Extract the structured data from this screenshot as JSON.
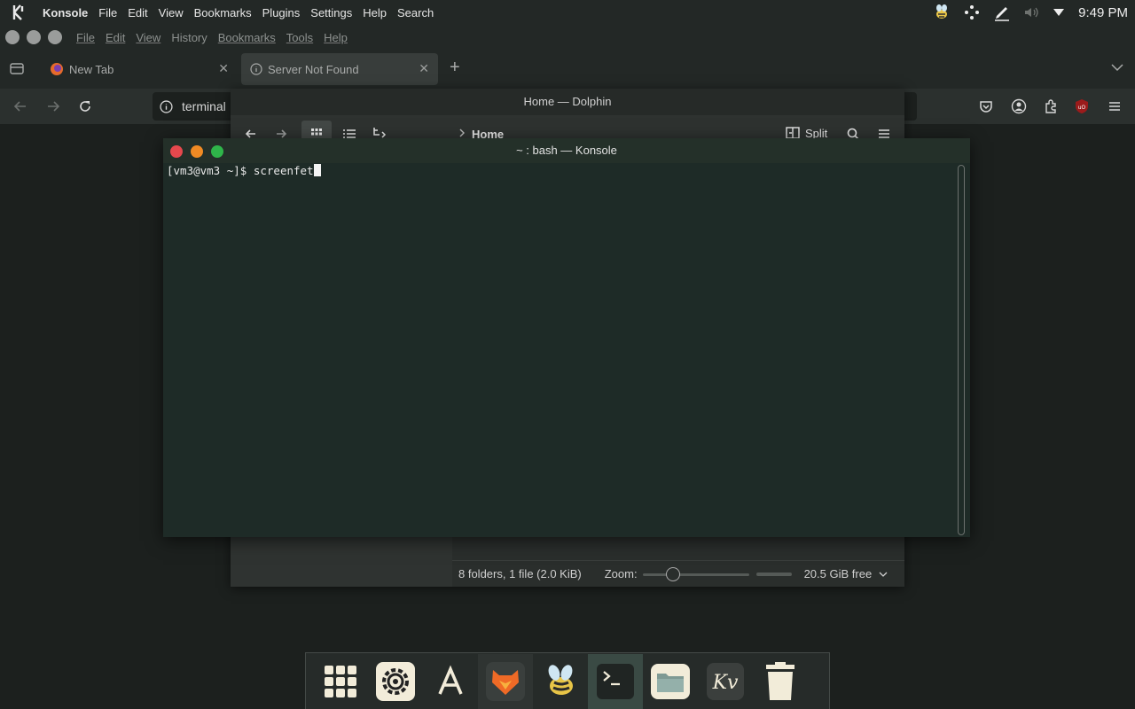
{
  "top_panel": {
    "app_name": "Konsole",
    "menu": [
      "File",
      "Edit",
      "View",
      "Bookmarks",
      "Plugins",
      "Settings",
      "Help",
      "Search"
    ],
    "tray_icons": [
      "bee-icon",
      "network-icon",
      "pen-icon",
      "volume-icon",
      "arrow-down-icon"
    ],
    "clock": "9:49 PM"
  },
  "firefox": {
    "menu": [
      "File",
      "Edit",
      "View",
      "History",
      "Bookmarks",
      "Tools",
      "Help"
    ],
    "tabs": [
      {
        "label": "New Tab"
      },
      {
        "label": "Server Not Found"
      }
    ],
    "url": "terminal"
  },
  "dolphin": {
    "title": "Home — Dolphin",
    "breadcrumb": "Home",
    "split_label": "Split",
    "status": "8 folders, 1 file (2.0 KiB)",
    "zoom_label": "Zoom:",
    "free_space": "20.5 GiB free"
  },
  "konsole": {
    "title": "~ : bash — Konsole",
    "prompt": "[vm3@vm3 ~]$ ",
    "command": "screenfet"
  },
  "dock": {
    "items": [
      "app-grid-icon",
      "settings-icon",
      "text-editor-icon",
      "firefox-icon",
      "bee-icon",
      "terminal-icon",
      "files-icon",
      "kv-icon",
      "trash-icon"
    ]
  },
  "colors": {
    "accent": "#3a4a44",
    "terminal_bg": "#1e2b27",
    "close": "#e5484d",
    "minimize": "#f08a24",
    "maximize": "#2fb54a"
  }
}
